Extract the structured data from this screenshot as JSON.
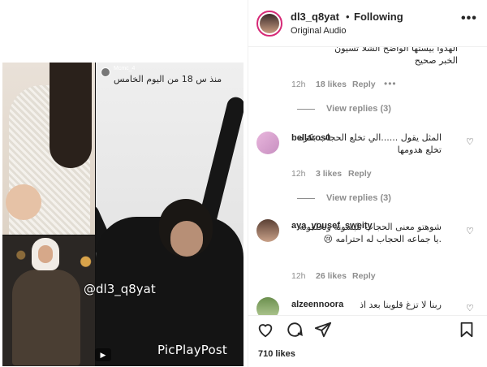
{
  "post": {
    "username": "dl3_q8yat",
    "separator": "•",
    "follow_status": "Following",
    "audio": "Original Audio",
    "likes": "710 likes"
  },
  "media": {
    "story_user": "Mcmc_4",
    "story_sub": "منذ س 18 من اليوم الخامس",
    "watermark": "@dl3_q8yat",
    "app_logo": "PicPlayPost"
  },
  "comments": {
    "partial": {
      "text_line1": "الهدوا بيستها الواضح الشلا تسيون",
      "text_line2": "الخبر صحيح",
      "time": "12h",
      "likes": "18 likes",
      "reply": "Reply",
      "more": "•••",
      "view_replies": "View replies (3)"
    },
    "items": [
      {
        "username": "bellaros0",
        "text": "المثل يقول ......الي تخلع الحجاب بكره تخلع هدومها",
        "time": "12h",
        "likes": "3 likes",
        "reply": "Reply",
        "view_replies": "View replies (3)"
      },
      {
        "username": "aya_yousef_sweity",
        "text": "شوهتو معنى الحجاب تلبسونه وتخلعونه .يا جماعه الحجاب له احترامه 😢",
        "time": "12h",
        "likes": "26 likes",
        "reply": "Reply"
      },
      {
        "username": "alzeennoora",
        "text": "ربنا لا تزغ قلوبنا بعد اذ"
      }
    ]
  },
  "icons": {
    "more": "more-horizontal-icon",
    "heart": "heart-icon",
    "comment": "comment-icon",
    "share": "share-icon",
    "save": "bookmark-icon"
  },
  "colors": {
    "story_ring": "#d62976",
    "muted": "#8e8e8e",
    "text": "#262626"
  }
}
